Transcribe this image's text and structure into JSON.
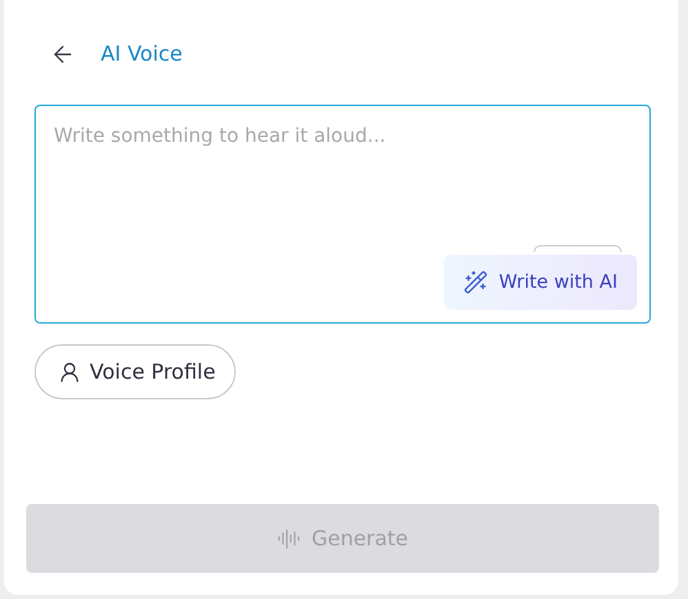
{
  "header": {
    "title": "AI Voice"
  },
  "editor": {
    "placeholder": "Write something to hear it aloud...",
    "write_with_ai": "Write with AI"
  },
  "voice_profile": {
    "label": "Voice Profile"
  },
  "generate": {
    "label": "Generate",
    "disabled": true
  }
}
